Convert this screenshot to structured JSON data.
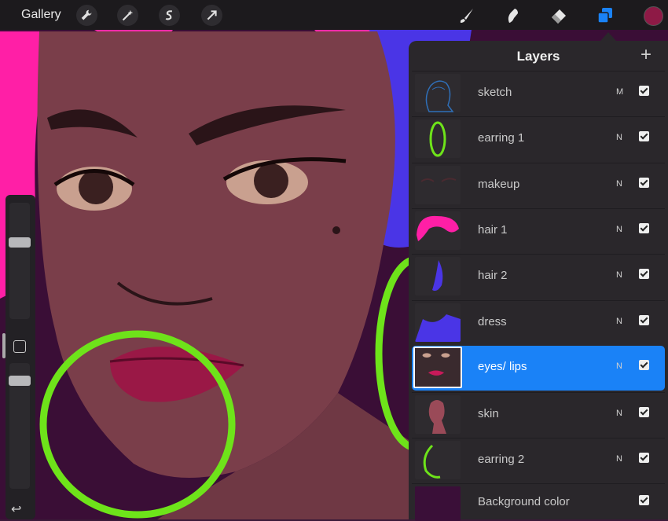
{
  "app": {
    "gallery_label": "Gallery",
    "left_tools": [
      {
        "name": "actions",
        "icon": "wrench-icon"
      },
      {
        "name": "adjustments",
        "icon": "magic-wand-icon"
      },
      {
        "name": "selection",
        "icon": "selection-s-icon"
      },
      {
        "name": "transform",
        "icon": "arrow-cursor-icon"
      }
    ],
    "right_tools": [
      {
        "name": "brush",
        "icon": "brush-icon"
      },
      {
        "name": "smudge",
        "icon": "smudge-icon"
      },
      {
        "name": "eraser",
        "icon": "eraser-icon"
      },
      {
        "name": "layers",
        "icon": "layers-icon",
        "active": true
      }
    ],
    "current_color": "#8e1a46",
    "accent_color": "#1a82f7"
  },
  "sidebar": {
    "size_slider_icon": "size-slider-thumb",
    "modify_icon": "square-modify-icon",
    "opacity_slider_icon": "opacity-slider-thumb",
    "undo_icon": "undo-arrow-icon",
    "undo_glyph": "↩"
  },
  "layers_panel": {
    "title": "Layers",
    "add_glyph": "+",
    "layers": [
      {
        "name": "sketch",
        "blend": "M",
        "visible": true,
        "selected": false
      },
      {
        "name": "earring 1",
        "blend": "N",
        "visible": true,
        "selected": false
      },
      {
        "name": "makeup",
        "blend": "N",
        "visible": true,
        "selected": false
      },
      {
        "name": "hair 1",
        "blend": "N",
        "visible": true,
        "selected": false
      },
      {
        "name": "hair 2",
        "blend": "N",
        "visible": true,
        "selected": false
      },
      {
        "name": "dress",
        "blend": "N",
        "visible": true,
        "selected": false
      },
      {
        "name": "eyes/ lips",
        "blend": "N",
        "visible": true,
        "selected": true
      },
      {
        "name": "skin",
        "blend": "N",
        "visible": true,
        "selected": false
      },
      {
        "name": "earring 2",
        "blend": "N",
        "visible": true,
        "selected": false
      }
    ],
    "background": {
      "name": "Background color",
      "color": "#3a0f38",
      "visible": true
    }
  }
}
